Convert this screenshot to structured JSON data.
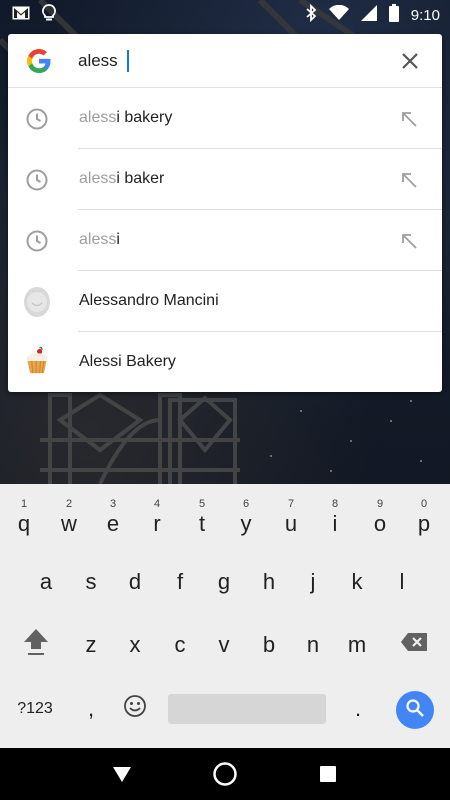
{
  "status_bar": {
    "time": "9:10",
    "icons": [
      "gmail-icon",
      "lightbulb-icon",
      "bluetooth-icon",
      "wifi-icon",
      "signal-icon",
      "battery-icon"
    ]
  },
  "search": {
    "query": "aless",
    "clear_icon": "close-icon",
    "logo": "google-g-logo"
  },
  "suggestions": [
    {
      "type": "history",
      "prefix": "aless",
      "rest": "i bakery",
      "icon": "history-icon"
    },
    {
      "type": "history",
      "prefix": "aless",
      "rest": "i baker",
      "icon": "history-icon"
    },
    {
      "type": "history",
      "prefix": "aless",
      "rest": "i",
      "icon": "history-icon"
    },
    {
      "type": "contact",
      "label": "Alessandro Mancini",
      "icon": "contact-avatar"
    },
    {
      "type": "app",
      "label": "Alessi Bakery",
      "icon": "cupcake-icon"
    }
  ],
  "keyboard": {
    "row1": [
      "q",
      "w",
      "e",
      "r",
      "t",
      "y",
      "u",
      "i",
      "o",
      "p"
    ],
    "row1_numbers": [
      "1",
      "2",
      "3",
      "4",
      "5",
      "6",
      "7",
      "8",
      "9",
      "0"
    ],
    "row2": [
      "a",
      "s",
      "d",
      "f",
      "g",
      "h",
      "j",
      "k",
      "l"
    ],
    "row3": [
      "z",
      "x",
      "c",
      "v",
      "b",
      "n",
      "m"
    ],
    "symbols_key": "?123",
    "comma_key": ",",
    "period_key": ".",
    "accent_color": "#4285f4"
  },
  "nav_bar": {
    "back": "back-icon",
    "home": "home-icon",
    "recents": "recents-icon"
  }
}
